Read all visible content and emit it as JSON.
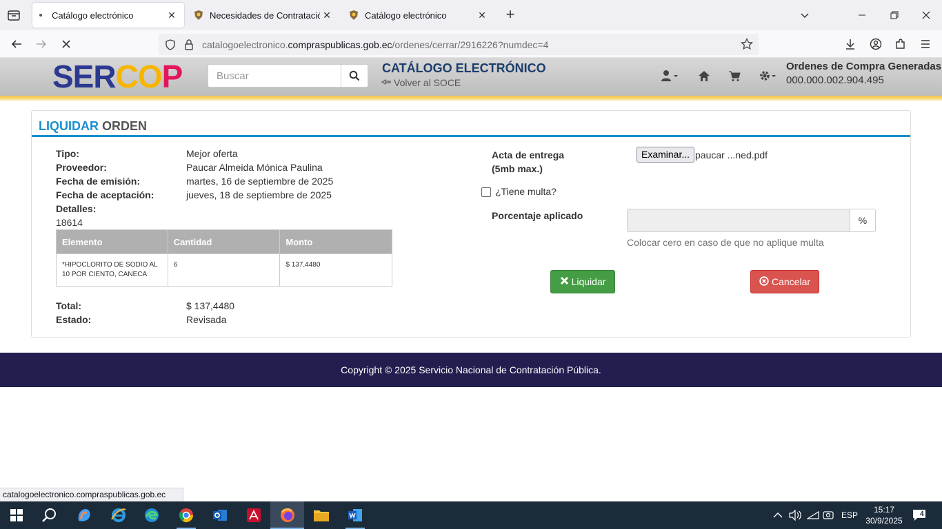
{
  "browser": {
    "tabs": [
      {
        "title": "Catálogo electrónico",
        "active": true
      },
      {
        "title": "Necesidades de Contratación y",
        "active": false
      },
      {
        "title": "Catálogo electrónico",
        "active": false
      }
    ],
    "url_prefix": "catalogoelectronico.",
    "url_domain": "compraspublicas.gob.ec",
    "url_path": "/ordenes/cerrar/2916226?numdec=4",
    "status_url": "catalogoelectronico.compraspublicas.gob.ec"
  },
  "header": {
    "logo_part1": "SER",
    "logo_part2": "CO",
    "logo_part3": "P",
    "search_placeholder": "Buscar",
    "catalog_title": "CATÁLOGO ELECTRÓNICO",
    "back_link": "Volver al SOCE",
    "orders_title": "Ordenes de Compra Generadas",
    "orders_count": "000.000.002.904.495"
  },
  "panel": {
    "title_part1": "LIQUIDAR",
    "title_part2": "ORDEN",
    "fields": {
      "tipo_label": "Tipo:",
      "tipo_value": "Mejor oferta",
      "proveedor_label": "Proveedor:",
      "proveedor_value": "Paucar Almeida Mónica Paulina",
      "emision_label": "Fecha de emisión:",
      "emision_value": "martes, 16 de septiembre de 2025",
      "aceptacion_label": "Fecha de aceptación:",
      "aceptacion_value": "jueves, 18 de septiembre de 2025",
      "detalles_label": "Detalles:",
      "detalles_value": "18614",
      "total_label": "Total:",
      "total_value": "$ 137,4480",
      "estado_label": "Estado:",
      "estado_value": "Revisada"
    },
    "table": {
      "headers": [
        "Elemento",
        "Cantidad",
        "Monto"
      ],
      "rows": [
        {
          "elemento_line1": "*HIPOCLORITO DE SODIO AL",
          "elemento_line2": "10 POR CIENTO, CANECA",
          "cantidad": "6",
          "monto": "$ 137,4480"
        }
      ]
    },
    "form": {
      "acta_label_line1": "Acta de entrega",
      "acta_label_line2": "(5mb max.)",
      "file_button": "Examinar...",
      "file_name": "paucar ...ned.pdf",
      "multa_label": "¿Tiene multa?",
      "multa_checked": false,
      "porcentaje_label": "Porcentaje aplicado",
      "porcentaje_value": "",
      "porcentaje_addon": "%",
      "help_text": "Colocar cero en caso de que no aplique multa",
      "liquidar_button": "Liquidar",
      "cancelar_button": "Cancelar"
    }
  },
  "footer": {
    "copyright": "Copyright © 2025 Servicio Nacional de Contratación Pública."
  },
  "taskbar": {
    "language": "ESP",
    "time": "15:17",
    "date": "30/9/2025",
    "notifications": "4"
  },
  "colors": {
    "accent_blue": "#1a8fcf",
    "success_green": "#449d44",
    "danger_red": "#d9534f",
    "footer_navy": "#221e4f",
    "logo_blue": "#2b3990",
    "logo_yellow": "#f7b500",
    "logo_red": "#e4155b"
  }
}
